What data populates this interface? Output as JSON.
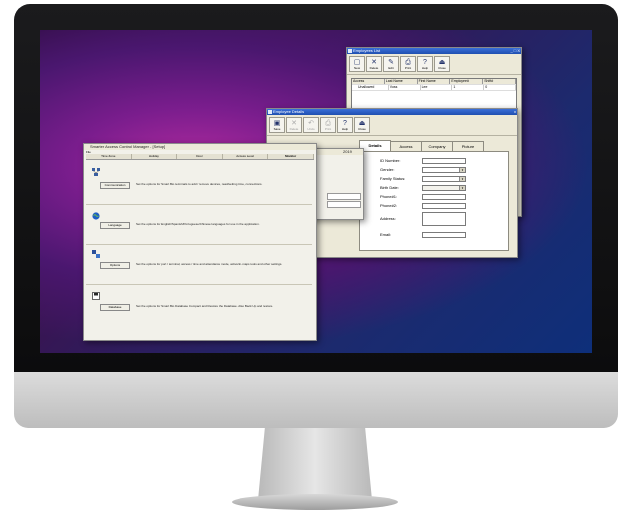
{
  "monitor": {
    "brand_color": "#1b1b1d",
    "chin_color": "#cfcfcf"
  },
  "employees_list": {
    "title": "Employees List",
    "controls": "_ □ X",
    "toolbar": [
      {
        "label": "New",
        "icon": "new-icon",
        "glyph": "▢"
      },
      {
        "label": "Delete",
        "icon": "delete-icon",
        "glyph": "✕"
      },
      {
        "label": "Edit",
        "icon": "edit-icon",
        "glyph": "✎"
      },
      {
        "label": "Print",
        "icon": "print-icon",
        "glyph": "⎙"
      },
      {
        "label": "Help",
        "icon": "help-icon",
        "glyph": "?"
      },
      {
        "label": "Close",
        "icon": "close-icon",
        "glyph": "⏏"
      }
    ],
    "columns": [
      "Access",
      "Last Name",
      "First Name",
      "Employee#",
      "Shift#"
    ],
    "rows": [
      [
        "Unallowed",
        "Voss",
        "Lee",
        "1",
        "0"
      ]
    ]
  },
  "employee_details": {
    "title": "Employee Details",
    "toolbar": [
      {
        "label": "Save",
        "icon": "save-icon",
        "glyph": "▣",
        "enabled": true
      },
      {
        "label": "Delete",
        "icon": "delete-icon",
        "glyph": "✕",
        "enabled": false
      },
      {
        "label": "Undo",
        "icon": "undo-icon",
        "glyph": "↶",
        "enabled": false
      },
      {
        "label": "Print",
        "icon": "print-icon",
        "glyph": "⎙",
        "enabled": false
      },
      {
        "label": "Help",
        "icon": "help-icon",
        "glyph": "?",
        "enabled": true
      },
      {
        "label": "Close",
        "icon": "close-icon",
        "glyph": "⏏",
        "enabled": true
      }
    ],
    "tabs": [
      "Details",
      "Access",
      "Company",
      "Picture"
    ],
    "active_tab": "Details",
    "fields": [
      {
        "label": "ID Number:",
        "value": "",
        "type": "text"
      },
      {
        "label": "Gender:",
        "value": "",
        "type": "select"
      },
      {
        "label": "Family Status:",
        "value": "",
        "type": "select"
      },
      {
        "label": "Birth Date:",
        "value": "",
        "type": "date"
      },
      {
        "label": "Phone#1:",
        "value": "",
        "type": "text"
      },
      {
        "label": "Phone#2:",
        "value": "",
        "type": "text"
      },
      {
        "label": "Address:",
        "value": "",
        "type": "textarea"
      },
      {
        "label": "Email:",
        "value": "",
        "type": "text"
      }
    ]
  },
  "access_manager": {
    "title": "Smarter Access Control Manager - [Setup]",
    "menu": "File",
    "columns": [
      "Time Zone",
      "Holiday",
      "Door",
      "Access Level",
      "Monitor"
    ],
    "sections": [
      {
        "icon": "network-icon",
        "button": "Communication",
        "description": "Set the options for Smart Bio terminals to add / remove devices, read/setting time, connections."
      },
      {
        "icon": "globe-icon",
        "button": "Language",
        "description": "Set the options for English/Spanish/Portuguese/Chinese languages for use in the application."
      },
      {
        "icon": "options-icon",
        "button": "Options",
        "description": "Set the options for port / terminal, access / time and attendance mode, active/in-maps tools and other settings."
      },
      {
        "icon": "database-icon",
        "button": "Database",
        "description": "Set the options for Smart Bio Database Compact and Restore the Database. Also Back Up and restore."
      }
    ]
  },
  "background_window": {
    "title": "2019"
  }
}
